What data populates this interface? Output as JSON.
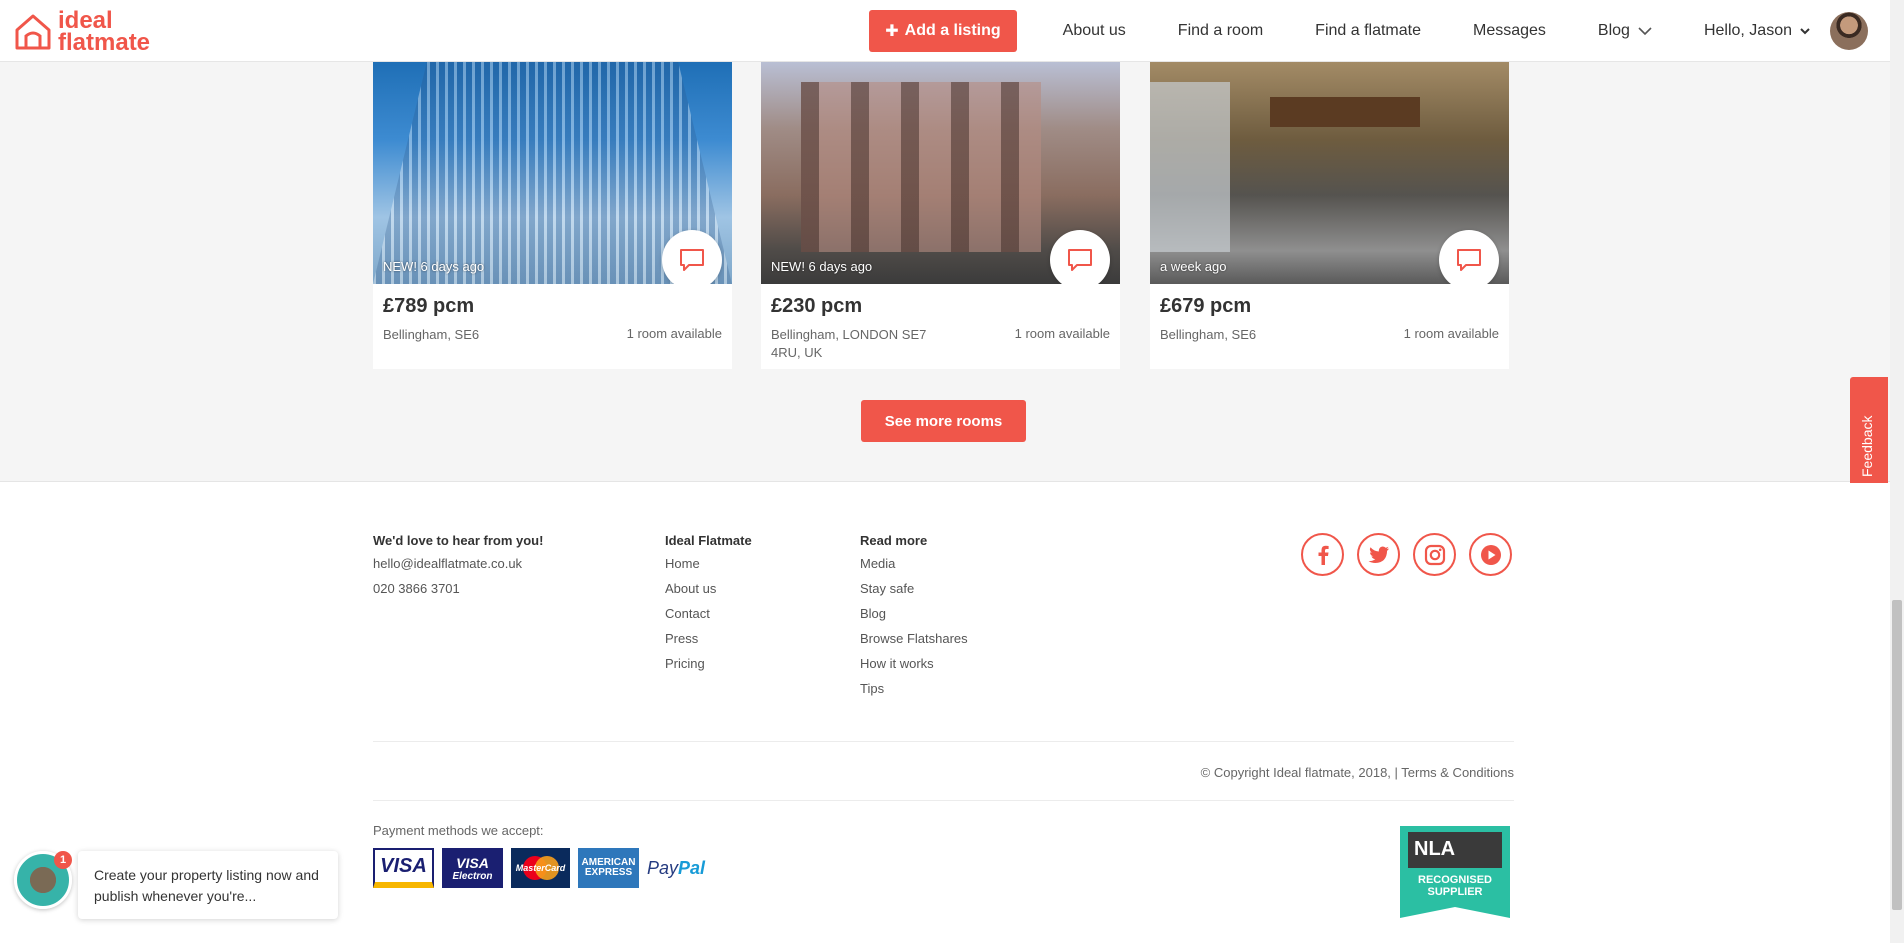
{
  "brand": {
    "logo_line1": "ideal",
    "logo_line2": "flatmate",
    "accent": "#f0564a"
  },
  "nav": {
    "add_listing": "Add a listing",
    "items": [
      "About us",
      "Find a room",
      "Find a flatmate",
      "Messages",
      "Blog"
    ],
    "user_greeting": "Hello, Jason"
  },
  "listings": [
    {
      "badge": "NEW! 6 days ago",
      "price": "£789 pcm",
      "location": "Bellingham, SE6",
      "rooms": "1 room available"
    },
    {
      "badge": "NEW! 6 days ago",
      "price": "£230 pcm",
      "location": "Bellingham, LONDON SE7 4RU, UK",
      "rooms": "1 room available"
    },
    {
      "badge": "a week ago",
      "price": "£679 pcm",
      "location": "Bellingham, SE6",
      "rooms": "1 room available"
    }
  ],
  "see_more": "See more rooms",
  "feedback": "Feedback",
  "footer": {
    "contact": {
      "heading": "We'd love to hear from you!",
      "email": "hello@idealflatmate.co.uk",
      "phone": "020 3866 3701"
    },
    "ideal_flatmate": {
      "heading": "Ideal Flatmate",
      "links": [
        "Home",
        "About us",
        "Contact",
        "Press",
        "Pricing"
      ]
    },
    "read_more": {
      "heading": "Read more",
      "links": [
        "Media",
        "Stay safe",
        "Blog",
        "Browse Flatshares",
        "How it works",
        "Tips"
      ]
    },
    "social": [
      "facebook-icon",
      "twitter-icon",
      "instagram-icon",
      "youtube-icon"
    ],
    "copyright": "© Copyright Ideal flatmate, 2018, | Terms & Conditions",
    "payment_label": "Payment methods we accept:",
    "payment_methods": {
      "visa": "VISA",
      "visa_electron_1": "VISA",
      "visa_electron_2": "Electron",
      "mastercard": "MasterCard",
      "amex_1": "AMERICAN",
      "amex_2": "EXPRESS",
      "paypal_1": "Pay",
      "paypal_2": "Pal"
    },
    "nla": {
      "abbr": "NLA",
      "line1": "RECOGNISED",
      "line2": "SUPPLIER"
    }
  },
  "chat": {
    "notification_count": "1",
    "message": "Create your property listing now and publish whenever you're..."
  }
}
